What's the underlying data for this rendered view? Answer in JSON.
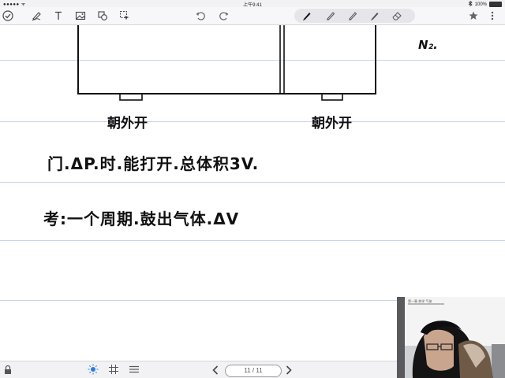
{
  "status_bar": {
    "carrier": "●●●●● ᯤ",
    "time": "上午9:41",
    "battery_percent": "100%"
  },
  "toolbar": {
    "left_tools": [
      "done-icon",
      "lasso-icon",
      "text-icon",
      "image-icon",
      "shapes-icon",
      "select-icon"
    ],
    "history_tools": [
      "undo-icon",
      "redo-icon"
    ],
    "pen_tools": [
      "pen-icon",
      "pencil-icon",
      "highlighter-icon",
      "marker-icon",
      "eraser-icon"
    ],
    "right_tools": [
      "star-icon",
      "menu-icon"
    ],
    "accent_color": "#2c7be5"
  },
  "notes": {
    "label_top_right": "N₂.",
    "label_left_valve": "朝外开",
    "label_right_valve": "朝外开",
    "line1": "门.ΔP.时.能打开.总体积3V.",
    "line2": "考:一个周期.鼓出气体.ΔV"
  },
  "bottom_bar": {
    "page_indicator": "11 / 11",
    "icons": [
      "lock-icon",
      "brightness-icon",
      "grid-icon",
      "list-icon",
      "prev-page-icon",
      "next-page-icon"
    ]
  },
  "webcam": {
    "whiteboard_caption": "第一章 热学 气体"
  }
}
